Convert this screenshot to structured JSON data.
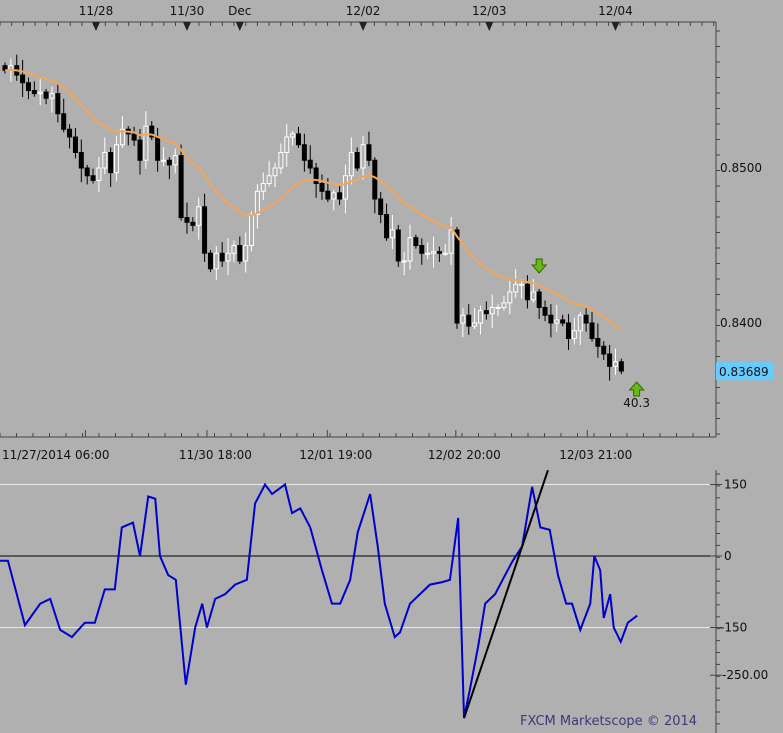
{
  "chart_data": [
    {
      "type": "candlestick",
      "title": "",
      "top_date_labels": [
        "11/28",
        "11/30",
        "Dec",
        "12/02",
        "12/03",
        "12/04"
      ],
      "top_date_bar_index": [
        15.5,
        31,
        40,
        61,
        82.5,
        104
      ],
      "x_tick_labels": [
        "11/27/2014 06:00",
        "11/30 18:00",
        "12/01 19:00",
        "12/02 20:00",
        "12/03 21:00"
      ],
      "x_tick_bar_index": [
        13.7,
        34.4,
        54.9,
        76.8,
        99.2
      ],
      "y_ticks": [
        0.85,
        0.84
      ],
      "y_tick_labels": [
        "0.8500",
        "0.8400"
      ],
      "ylim": [
        0.8325,
        0.8594
      ],
      "current_price": "0.83689",
      "current_price_color": "#66ccff",
      "moving_average_color": "#f5a55a",
      "closes": [
        0.8563,
        0.8566,
        0.856,
        0.8555,
        0.855,
        0.8548,
        0.8549,
        0.8545,
        0.8548,
        0.8535,
        0.8525,
        0.852,
        0.851,
        0.85,
        0.8495,
        0.8492,
        0.85,
        0.851,
        0.8497,
        0.8515,
        0.8525,
        0.8522,
        0.8518,
        0.8505,
        0.8527,
        0.852,
        0.8505,
        0.8505,
        0.8502,
        0.8508,
        0.8468,
        0.8465,
        0.8463,
        0.8475,
        0.8445,
        0.8435,
        0.8445,
        0.844,
        0.8445,
        0.845,
        0.844,
        0.845,
        0.847,
        0.8485,
        0.849,
        0.8495,
        0.85,
        0.851,
        0.852,
        0.8522,
        0.8515,
        0.8505,
        0.85,
        0.849,
        0.8485,
        0.848,
        0.8484,
        0.848,
        0.8495,
        0.851,
        0.85,
        0.8515,
        0.8505,
        0.848,
        0.847,
        0.8455,
        0.846,
        0.844,
        0.844,
        0.8455,
        0.845,
        0.8445,
        0.8445,
        0.8446,
        0.8445,
        0.8445,
        0.846,
        0.84,
        0.8405,
        0.8398,
        0.84,
        0.8408,
        0.8406,
        0.841,
        0.841,
        0.8413,
        0.842,
        0.8425,
        0.8425,
        0.8415,
        0.842,
        0.841,
        0.8405,
        0.84,
        0.8402,
        0.84,
        0.839,
        0.8395,
        0.8405,
        0.84,
        0.839,
        0.8385,
        0.838,
        0.8372,
        0.8375,
        0.8369
      ],
      "signals": [
        {
          "type": "sell-arrow",
          "bar_index": 91,
          "label": ""
        },
        {
          "type": "buy-arrow",
          "bar_index": 107.6,
          "label": "40.3"
        }
      ]
    },
    {
      "type": "line",
      "name": "CCI",
      "y_ticks": [
        150,
        0,
        -150,
        -250
      ],
      "y_tick_labels": [
        "150",
        "0",
        "-150",
        "-250.00"
      ],
      "ylim": [
        -370,
        180
      ],
      "line_color": "#0000cc",
      "points": [
        [
          -0.9,
          -10
        ],
        [
          0.5,
          -10
        ],
        [
          3.4,
          -145
        ],
        [
          6.0,
          -100
        ],
        [
          7.7,
          -90
        ],
        [
          9.4,
          -155
        ],
        [
          11.4,
          -170
        ],
        [
          13.6,
          -140
        ],
        [
          15.3,
          -140
        ],
        [
          17.0,
          -70
        ],
        [
          18.7,
          -70
        ],
        [
          19.9,
          60
        ],
        [
          21.8,
          70
        ],
        [
          23.0,
          0
        ],
        [
          24.4,
          125
        ],
        [
          25.6,
          120
        ],
        [
          26.4,
          0
        ],
        [
          27.8,
          -40
        ],
        [
          29.1,
          -50
        ],
        [
          30.8,
          -270
        ],
        [
          32.4,
          -150
        ],
        [
          33.6,
          -100
        ],
        [
          34.4,
          -150
        ],
        [
          35.8,
          -90
        ],
        [
          37.5,
          -80
        ],
        [
          39.2,
          -60
        ],
        [
          41.2,
          -50
        ],
        [
          42.6,
          110
        ],
        [
          44.3,
          150
        ],
        [
          45.5,
          130
        ],
        [
          47.7,
          150
        ],
        [
          48.9,
          90
        ],
        [
          50.3,
          100
        ],
        [
          52.0,
          60
        ],
        [
          54.0,
          -30
        ],
        [
          55.7,
          -100
        ],
        [
          57.1,
          -100
        ],
        [
          58.8,
          -50
        ],
        [
          60.1,
          50
        ],
        [
          62.2,
          130
        ],
        [
          63.5,
          20
        ],
        [
          64.7,
          -100
        ],
        [
          66.4,
          -170
        ],
        [
          67.3,
          -160
        ],
        [
          69.0,
          -100
        ],
        [
          70.7,
          -80
        ],
        [
          72.4,
          -60
        ],
        [
          74.4,
          -55
        ],
        [
          75.8,
          -50
        ],
        [
          77.2,
          80
        ],
        [
          78.2,
          -340
        ],
        [
          79.2,
          -280
        ],
        [
          80.6,
          -190
        ],
        [
          81.8,
          -100
        ],
        [
          83.5,
          -80
        ],
        [
          85.2,
          -40
        ],
        [
          86.5,
          -10
        ],
        [
          88.1,
          20
        ],
        [
          89.8,
          145
        ],
        [
          91.2,
          60
        ],
        [
          92.8,
          55
        ],
        [
          94.2,
          -40
        ],
        [
          95.6,
          -100
        ],
        [
          96.6,
          -100
        ],
        [
          98.0,
          -155
        ],
        [
          99.7,
          -100
        ],
        [
          100.4,
          0
        ],
        [
          101.4,
          -30
        ],
        [
          102.0,
          -130
        ],
        [
          103.1,
          -80
        ],
        [
          103.7,
          -150
        ],
        [
          104.9,
          -180
        ],
        [
          106.1,
          -140
        ],
        [
          107.7,
          -125
        ]
      ],
      "trendline": [
        [
          78.2,
          -340
        ],
        [
          92.5,
          180
        ]
      ]
    }
  ],
  "watermark": "FXCM Marketscope © 2014"
}
